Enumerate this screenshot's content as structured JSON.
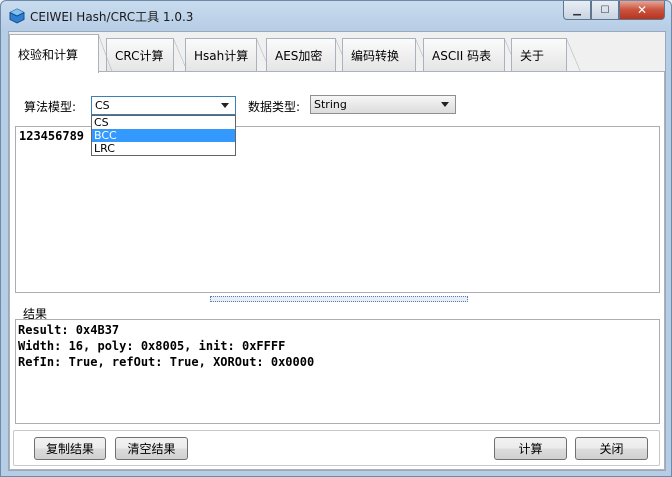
{
  "window": {
    "title": "CEIWEI Hash/CRC工具 1.0.3",
    "controls": {
      "minimize": "▁",
      "maximize": "☐",
      "close": "✕"
    }
  },
  "tabs": [
    {
      "label": "校验和计算",
      "active": true
    },
    {
      "label": "CRC计算",
      "active": false
    },
    {
      "label": "Hsah计算",
      "active": false
    },
    {
      "label": "AES加密",
      "active": false
    },
    {
      "label": "编码转换",
      "active": false
    },
    {
      "label": "ASCII 码表",
      "active": false
    },
    {
      "label": "关于",
      "active": false
    }
  ],
  "form": {
    "algorithm_label": "算法模型:",
    "algorithm_value": "CS",
    "algorithm_options": [
      "CS",
      "BCC",
      "LRC"
    ],
    "algorithm_highlighted": "BCC",
    "datatype_label": "数据类型:",
    "datatype_value": "String"
  },
  "input": {
    "text": "123456789"
  },
  "result": {
    "heading": "结果",
    "lines": [
      "Result: 0x4B37",
      "Width: 16, poly: 0x8005, init: 0xFFFF",
      "RefIn: True, refOut: True, XOROut: 0x0000"
    ]
  },
  "buttons": {
    "copy": "复制结果",
    "clear": "清空结果",
    "compute": "计算",
    "close": "关闭"
  }
}
